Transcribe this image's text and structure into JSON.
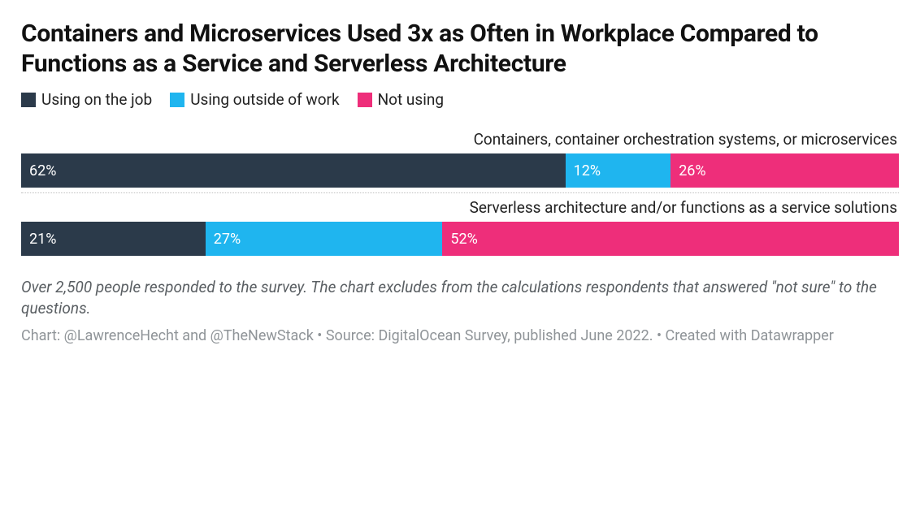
{
  "title": "Containers and Microservices Used 3x as Often in Workplace Compared to Functions as a Service and Serverless Architecture",
  "legend": {
    "items": [
      {
        "label": "Using on the job",
        "color": "#2b3a4a"
      },
      {
        "label": "Using outside of work",
        "color": "#1fb5ef"
      },
      {
        "label": "Not using",
        "color": "#ee2e7a"
      }
    ]
  },
  "chart_data": {
    "type": "bar",
    "stacked": true,
    "orientation": "horizontal",
    "unit": "%",
    "xlim": [
      0,
      100
    ],
    "categories": [
      "Containers, container orchestration systems, or microservices",
      "Serverless architecture and/or functions as a service solutions"
    ],
    "series": [
      {
        "name": "Using on the job",
        "color": "#2b3a4a",
        "values": [
          62,
          21
        ]
      },
      {
        "name": "Using outside of work",
        "color": "#1fb5ef",
        "values": [
          12,
          27
        ]
      },
      {
        "name": "Not using",
        "color": "#ee2e7a",
        "values": [
          26,
          52
        ]
      }
    ]
  },
  "rows": [
    {
      "label": "Containers, container orchestration systems, or microservices",
      "segs": [
        {
          "text": "62%",
          "width": "62%",
          "bg": "#2b3a4a"
        },
        {
          "text": "12%",
          "width": "12%",
          "bg": "#1fb5ef"
        },
        {
          "text": "26%",
          "width": "26%",
          "bg": "#ee2e7a"
        }
      ]
    },
    {
      "label": "Serverless architecture and/or functions as a service solutions",
      "segs": [
        {
          "text": "21%",
          "width": "21%",
          "bg": "#2b3a4a"
        },
        {
          "text": "27%",
          "width": "27%",
          "bg": "#1fb5ef"
        },
        {
          "text": "52%",
          "width": "52%",
          "bg": "#ee2e7a"
        }
      ]
    }
  ],
  "footnote": "Over 2,500 people responded to the survey. The chart excludes from the calculations respondents that answered \"not sure\" to the questions.",
  "credit": "Chart: @LawrenceHecht and @TheNewStack • Source: DigitalOcean Survey, published June 2022. • Created with Datawrapper"
}
